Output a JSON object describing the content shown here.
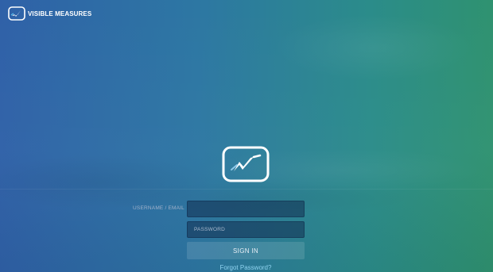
{
  "header": {
    "brand_name": "VISIBLE MEASURES",
    "brand_icon": "checkmark-badge-icon"
  },
  "login": {
    "logo_icon": "checkmark-badge-icon",
    "username_label": "USERNAME / EMAIL",
    "username_value": "",
    "password_placeholder": "PASSWORD",
    "password_value": "",
    "signin_label": "SIGN IN",
    "forgot_label": "Forgot Password?"
  },
  "colors": {
    "background_left": "#2f61a8",
    "background_right": "#2f9270",
    "link": "#8fd3f0"
  }
}
